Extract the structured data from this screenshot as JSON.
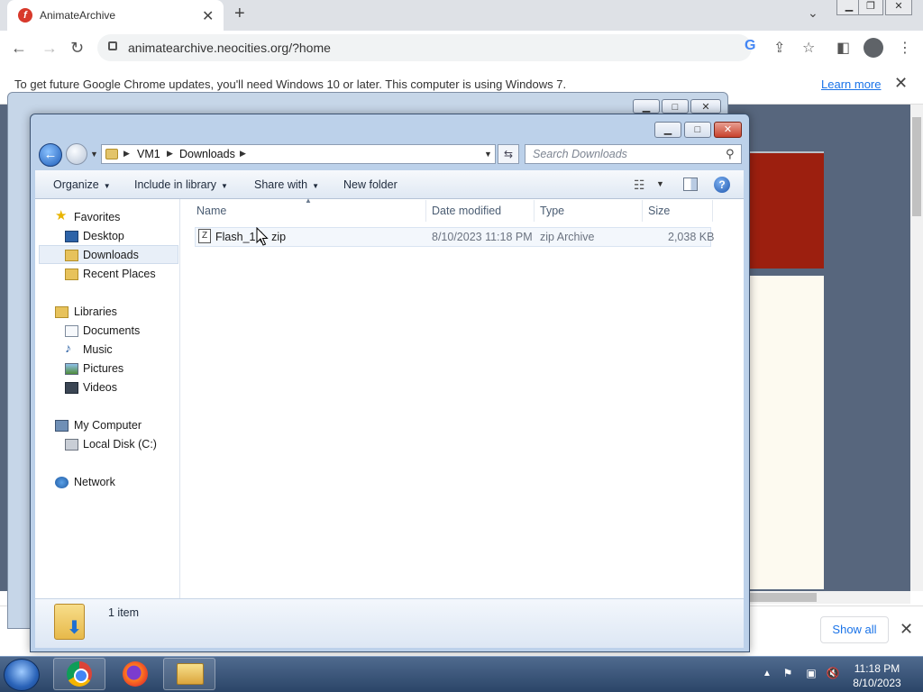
{
  "browser": {
    "tab_title": "AnimateArchive",
    "tab_favicon": "flash-icon",
    "url": "animatearchive.neocities.org/?home",
    "infobar_message": "To get future Google Chrome updates, you'll need Windows 10 or later. This computer is using Windows 7.",
    "infobar_link": "Learn more",
    "show_all_label": "Show all"
  },
  "explorer": {
    "breadcrumb": [
      "VM1",
      "Downloads"
    ],
    "search_placeholder": "Search Downloads",
    "commands": {
      "organize": "Organize",
      "include_in_library": "Include in library",
      "share_with": "Share with",
      "new_folder": "New folder"
    },
    "nav": {
      "favorites": "Favorites",
      "desktop": "Desktop",
      "downloads": "Downloads",
      "recent_places": "Recent Places",
      "libraries": "Libraries",
      "documents": "Documents",
      "music": "Music",
      "pictures": "Pictures",
      "videos": "Videos",
      "my_computer": "My Computer",
      "local_disk": "Local Disk (C:)",
      "network": "Network"
    },
    "columns": [
      "Name",
      "Date modified",
      "Type",
      "Size"
    ],
    "files": [
      {
        "name": "Flash_1 (",
        "name_ext": "zip",
        "date_modified": "8/10/2023 11:18 PM",
        "type": "zip Archive",
        "size": "2,038 KB"
      }
    ],
    "item_count": "1 item"
  },
  "taskbar": {
    "time": "11:18 PM",
    "date": "8/10/2023"
  },
  "colors": {
    "page_background": "#57667d",
    "page_red": "#9c1f0f",
    "explorer_frame": "#bcd1ea",
    "link_blue": "#1a73e8"
  }
}
